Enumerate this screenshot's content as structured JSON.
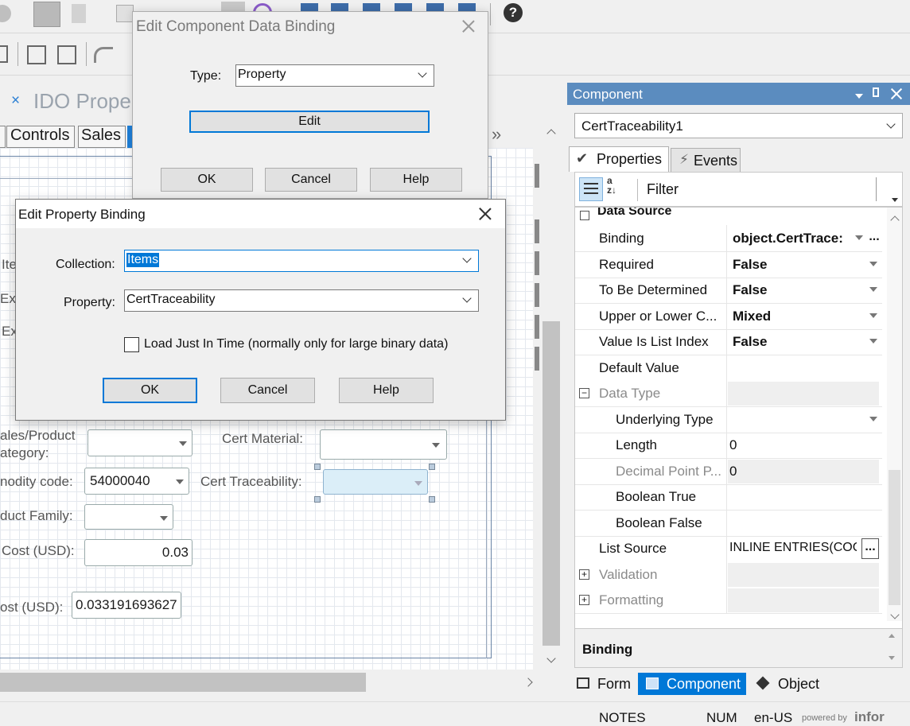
{
  "bg_dialog": {
    "title": "Edit Component Data Binding",
    "type_label": "Type:",
    "type_value": "Property",
    "edit_button": "Edit",
    "ok_button": "OK",
    "cancel_button": "Cancel",
    "help_button": "Help"
  },
  "fg_dialog": {
    "title": "Edit Property Binding",
    "collection_label": "Collection:",
    "collection_value": "Items",
    "property_label": "Property:",
    "property_value": "CertTraceability",
    "load_jit_label": "Load Just In Time (normally only for large binary data)",
    "load_jit_checked": false,
    "ok_button": "OK",
    "cancel_button": "Cancel",
    "help_button": "Help"
  },
  "designer": {
    "doc_tab_close": "×",
    "doc_tab_title": "IDO Prope",
    "tabs": [
      "Controls",
      "Sales"
    ],
    "overflow_chevron": "»",
    "partial_labels": [
      "Ite",
      "Ex",
      "Ex"
    ],
    "fields": {
      "sales_category_label_1": "ales/Product",
      "sales_category_label_2": "ategory:",
      "cert_material_label": "Cert Material:",
      "commodity_label": "nodity code:",
      "commodity_value": "54000040",
      "cert_traceability_label": "Cert Traceability:",
      "product_family_label": "duct Family:",
      "cost_label": "Cost (USD):",
      "cost_value": "0.03",
      "cost2_label": "ost (USD):",
      "cost2_value": "0.033191693627"
    }
  },
  "component_panel": {
    "title": "Component",
    "selector_value": "CertTraceability1",
    "tabs": {
      "properties": "Properties",
      "events": "Events"
    },
    "filter_label": "Filter",
    "section_partial": "Data Source",
    "rows": [
      {
        "name": "Binding",
        "value": "object.CertTrace:",
        "bold": true,
        "dropdown": true,
        "ellipsis": "..."
      },
      {
        "name": "Required",
        "value": "False",
        "bold": true,
        "dropdown": true
      },
      {
        "name": "To Be Determined",
        "value": "False",
        "bold": true,
        "dropdown": true
      },
      {
        "name": "Upper or Lower C...",
        "value": "Mixed",
        "bold": true,
        "dropdown": true
      },
      {
        "name": "Value Is List Index",
        "value": "False",
        "bold": true,
        "dropdown": true
      },
      {
        "name": "Default Value",
        "value": ""
      },
      {
        "name": "Data Type",
        "value": "",
        "group": true,
        "expander": "−"
      },
      {
        "name": "Underlying Type",
        "value": "",
        "indent": true,
        "dropdown": true
      },
      {
        "name": "Length",
        "value": "0",
        "indent": true
      },
      {
        "name": "Decimal Point P...",
        "value": "0",
        "indent": true,
        "disabled": true
      },
      {
        "name": "Boolean True",
        "value": "",
        "indent": true
      },
      {
        "name": "Boolean False",
        "value": "",
        "indent": true
      },
      {
        "name": "List Source",
        "value": "INLINE ENTRIES(COC",
        "ellipsis": "..."
      },
      {
        "name": "Validation",
        "value": "",
        "group": true,
        "expander": "+"
      },
      {
        "name": "Formatting",
        "value": "",
        "group": true,
        "expander": "+"
      }
    ],
    "description_title": "Binding",
    "bottom_tabs": {
      "form": "Form",
      "component": "Component",
      "object": "Object"
    }
  },
  "status_bar": {
    "notes": "NOTES",
    "num": "NUM",
    "locale": "en-US",
    "powered_by": "powered by",
    "brand": "infor"
  },
  "help_icon": "?",
  "colors": {
    "accent_blue": "#0078d7",
    "panel_header": "#5b8cbf",
    "selection": "#0078d7"
  }
}
